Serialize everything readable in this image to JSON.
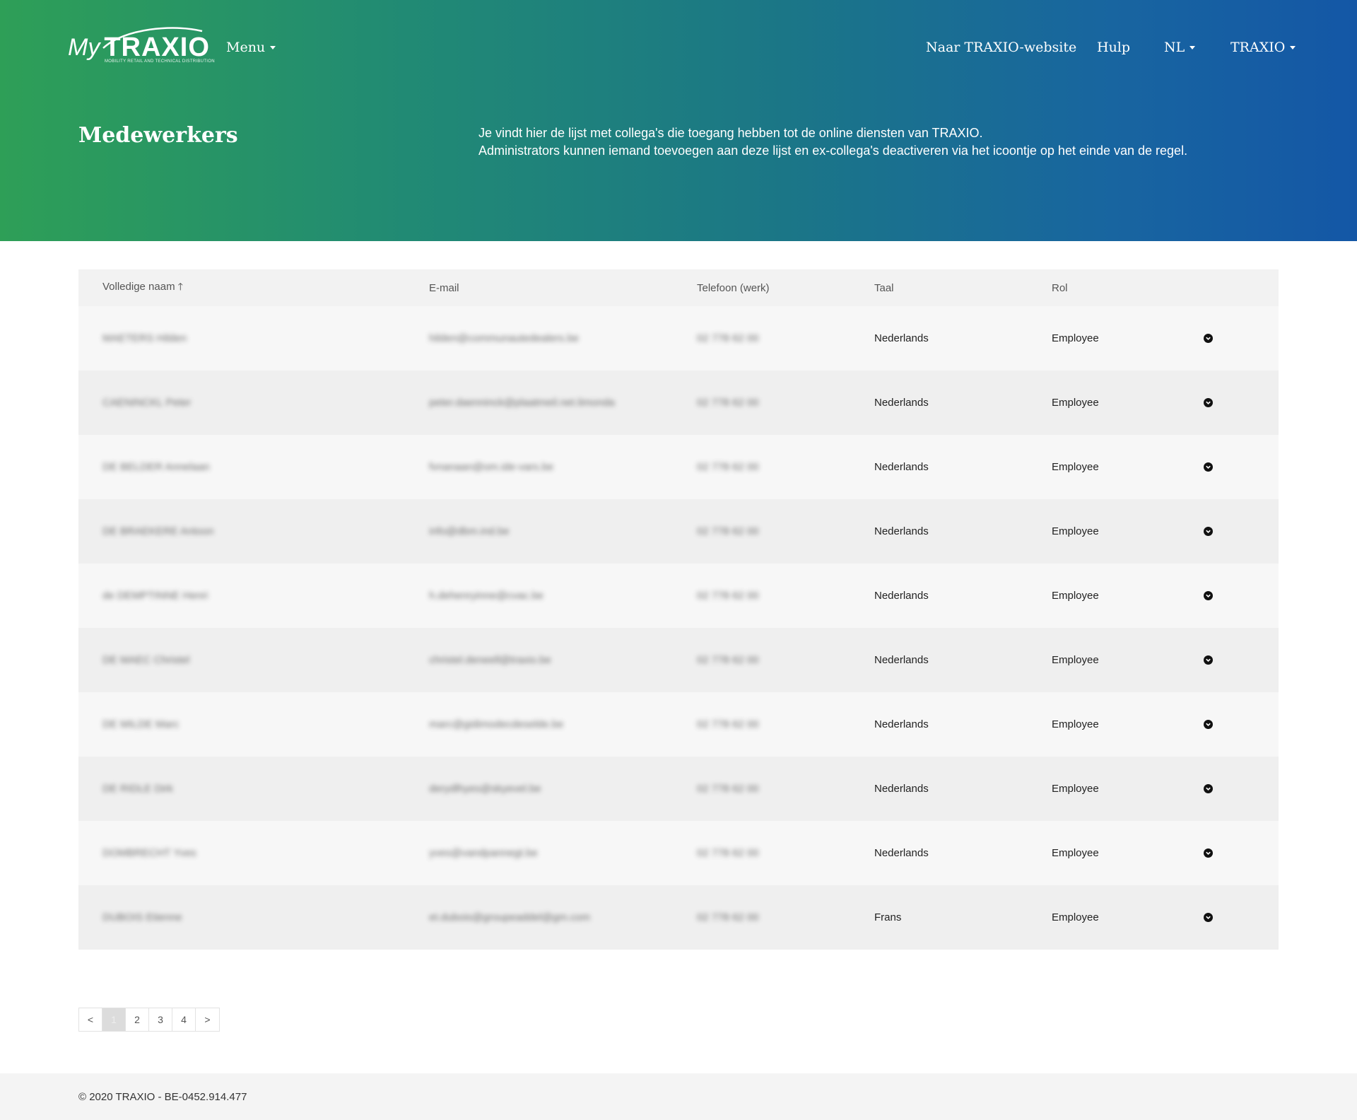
{
  "header": {
    "logo_my": "My",
    "logo_brand": "TRAXIO",
    "logo_tagline": "MOBILITY RETAIL AND TECHNICAL DISTRIBUTION",
    "menu_label": "Menu",
    "website_link": "Naar TRAXIO-website",
    "help_link": "Hulp",
    "language": "NL",
    "account": "TRAXIO"
  },
  "page": {
    "title": "Medewerkers",
    "intro_line1": "Je vindt hier de lijst met collega's die toegang hebben tot de online diensten van TRAXIO.",
    "intro_line2": "Administrators kunnen iemand toevoegen aan deze lijst en ex-collega's deactiveren via het icoontje op het einde van de regel."
  },
  "table": {
    "columns": {
      "name": "Volledige naam",
      "email": "E-mail",
      "phone": "Telefoon (werk)",
      "language": "Taal",
      "role": "Rol"
    },
    "rows": [
      {
        "name": "MAETERS Hilden",
        "email": "hilden@communautedealers.be",
        "phone": "02 778 62 00",
        "language": "Nederlands",
        "role": "Employee"
      },
      {
        "name": "CAENINCKL Peter",
        "email": "peter.daenninck@plaatmeil.net.limonda",
        "phone": "02 778 62 00",
        "language": "Nederlands",
        "role": "Employee"
      },
      {
        "name": "DE BELDER Annelaan",
        "email": "fvnanaan@om.ide-vars.be",
        "phone": "02 778 62 00",
        "language": "Nederlands",
        "role": "Employee"
      },
      {
        "name": "DE BRAEKERE Antoon",
        "email": "info@dbm.ind.be",
        "phone": "02 778 62 00",
        "language": "Nederlands",
        "role": "Employee"
      },
      {
        "name": "de DEMPTINNE Henri",
        "email": "h.dehenryinne@cvac.be",
        "phone": "02 778 62 00",
        "language": "Nederlands",
        "role": "Employee"
      },
      {
        "name": "DE MAEC Christel",
        "email": "christel.deneell@traxio.be",
        "phone": "02 778 62 00",
        "language": "Nederlands",
        "role": "Employee"
      },
      {
        "name": "DE MILDE Marc",
        "email": "marc@gidimodecdeselde.be",
        "phone": "02 778 62 00",
        "language": "Nederlands",
        "role": "Employee"
      },
      {
        "name": "DE RIDLE Dirk",
        "email": "derydlhyes@skyevel.be",
        "phone": "02 778 62 00",
        "language": "Nederlands",
        "role": "Employee"
      },
      {
        "name": "DOMBRECHT Yves",
        "email": "yves@vandpannegt.be",
        "phone": "02 778 62 00",
        "language": "Nederlands",
        "role": "Employee"
      },
      {
        "name": "DUBOIS Etienne",
        "email": "et.dubois@groupeaddel@gm.com",
        "phone": "02 778 62 00",
        "language": "Frans",
        "role": "Employee"
      }
    ]
  },
  "pagination": {
    "prev": "<",
    "pages": [
      "1",
      "2",
      "3",
      "4"
    ],
    "next": ">",
    "current": "1"
  },
  "footer": {
    "copyright": "© 2020 TRAXIO - BE-0452.914.477"
  }
}
